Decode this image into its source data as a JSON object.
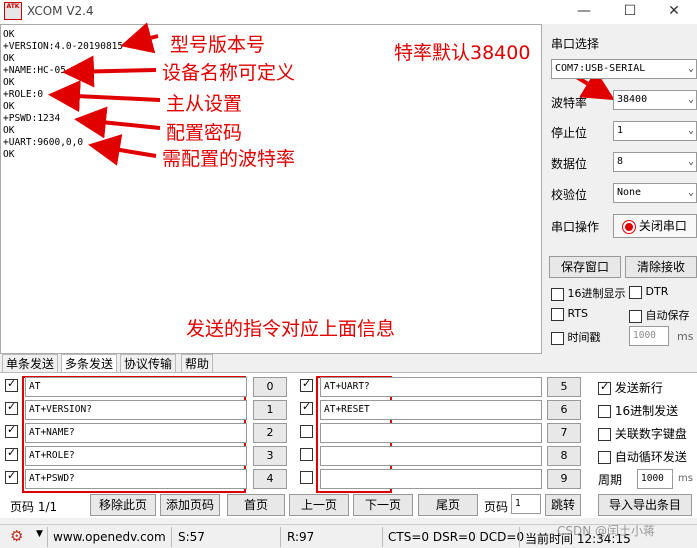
{
  "window": {
    "logo_text": "ATK",
    "title": "XCOM V2.4",
    "minimize": "—",
    "maximize": "☐",
    "close": "✕"
  },
  "receive_lines": [
    "OK",
    "+VERSION:4.0-20190815",
    "OK",
    "+NAME:HC-05",
    "OK",
    "+ROLE:0",
    "OK",
    "+PSWD:1234",
    "OK",
    "+UART:9600,0,0",
    "OK"
  ],
  "annotations": {
    "model_version": "型号版本号",
    "device_name": "设备名称可定义",
    "master_slave": "主从设置",
    "password": "配置密码",
    "baud_needed": "需配置的波特率",
    "default_baud": "特率默认38400",
    "send_info": "发送的指令对应上面信息"
  },
  "serial": {
    "section_label": "串口选择",
    "port": "COM7:USB-SERIAL",
    "baud_label": "波特率",
    "baud": "38400",
    "stop_label": "停止位",
    "stop": "1",
    "data_label": "数据位",
    "data_bits": "8",
    "parity_label": "校验位",
    "parity": "None",
    "op_label": "串口操作",
    "op_button": "关闭串口",
    "save_window": "保存窗口",
    "clear_recv": "清除接收",
    "hex_display": "16进制显示",
    "dtr": "DTR",
    "rts": "RTS",
    "auto_save": "自动保存",
    "timestamp": "时间戳",
    "timestamp_ms": "1000",
    "ms": "ms"
  },
  "tabs": [
    "单条发送",
    "多条发送",
    "协议传输",
    "帮助"
  ],
  "multi_send": {
    "left": [
      {
        "checked": true,
        "cmd": "AT",
        "num": "0"
      },
      {
        "checked": true,
        "cmd": "AT+VERSION?",
        "num": "1"
      },
      {
        "checked": true,
        "cmd": "AT+NAME?",
        "num": "2"
      },
      {
        "checked": true,
        "cmd": "AT+ROLE?",
        "num": "3"
      },
      {
        "checked": true,
        "cmd": "AT+PSWD?",
        "num": "4"
      }
    ],
    "right": [
      {
        "checked": true,
        "cmd": "AT+UART?",
        "num": "5"
      },
      {
        "checked": true,
        "cmd": "AT+RESET",
        "num": "6"
      },
      {
        "checked": false,
        "cmd": "",
        "num": "7"
      },
      {
        "checked": false,
        "cmd": "",
        "num": "8"
      },
      {
        "checked": false,
        "cmd": "",
        "num": "9"
      }
    ],
    "opt_send_newline": "发送新行",
    "opt_hex_send": "16进制发送",
    "opt_keypad": "关联数字键盘",
    "opt_loop": "自动循环发送",
    "period_label": "周期",
    "period": "1000",
    "period_unit": "ms",
    "page_label": "页码 1/1",
    "remove_page": "移除此页",
    "add_page": "添加页码",
    "first_page": "首页",
    "prev_page": "上一页",
    "next_page": "下一页",
    "last_page": "尾页",
    "goto_label": "页码",
    "goto_value": "1",
    "goto_button": "跳转",
    "import_export": "导入导出条目"
  },
  "status": {
    "url": "www.openedv.com",
    "s": "S:57",
    "r": "R:97",
    "lines": "CTS=0 DSR=0 DCD=0",
    "time": "当前时间 12:34:15",
    "watermark": "CSDN @闰土小蒋"
  },
  "colors": {
    "annotation": "#e00000"
  }
}
